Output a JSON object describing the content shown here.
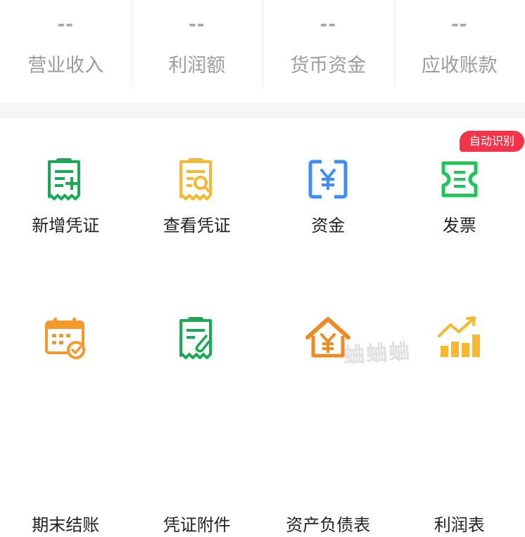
{
  "stats": [
    {
      "value": "--",
      "label": "营业收入"
    },
    {
      "value": "--",
      "label": "利润额"
    },
    {
      "value": "--",
      "label": "货币资金"
    },
    {
      "value": "--",
      "label": "应收账款"
    }
  ],
  "grid": {
    "items": [
      {
        "label": "新增凭证",
        "icon": "add-voucher-icon",
        "color": "#1aaa55"
      },
      {
        "label": "查看凭证",
        "icon": "view-voucher-icon",
        "color": "#f5b82e"
      },
      {
        "label": "资金",
        "icon": "fund-icon",
        "color": "#3e8ef7"
      },
      {
        "label": "发票",
        "icon": "invoice-icon",
        "color": "#20c45b"
      },
      {
        "label": "期末结账",
        "icon": "calendar-close-icon",
        "color": "#f39a2b"
      },
      {
        "label": "凭证附件",
        "icon": "voucher-attachment-icon",
        "color": "#1aaa55"
      },
      {
        "label": "资产负债表",
        "icon": "balance-sheet-icon",
        "color": "#f08a24"
      },
      {
        "label": "利润表",
        "icon": "profit-chart-icon",
        "color": "#f5b82e"
      }
    ],
    "badge": "自动识别"
  },
  "watermark": "蛐蛐蛐"
}
